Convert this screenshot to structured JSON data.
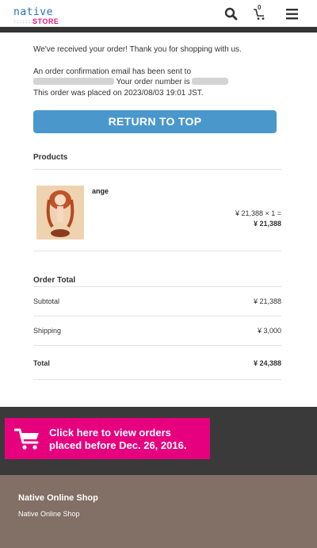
{
  "header": {
    "logo_top": "native",
    "logo_dots": "::::::::",
    "logo_store": "STORE",
    "cart_count": "0",
    "icons": {
      "search": "search-icon",
      "cart": "cart-icon",
      "menu": "hamburger-menu-icon"
    }
  },
  "confirmation": {
    "line1": "We've received your order! Thank you for shopping with us.",
    "line2": "An order confirmation email has been sent to",
    "line3": "Your order number is",
    "line4": "This order was placed on 2023/08/03 19:01 JST."
  },
  "return_button": "RETURN TO TOP",
  "products": {
    "title": "Products",
    "items": [
      {
        "name": "ange",
        "unit_price": "¥ 21,388 × 1 =",
        "total": "¥ 21,388"
      }
    ]
  },
  "order_total": {
    "title": "Order Total",
    "subtotal_label": "Subtotal",
    "subtotal_value": "¥ 21,388",
    "shipping_label": "Shipping",
    "shipping_value": "¥ 3,000",
    "total_label": "Total",
    "total_value": "¥ 24,388"
  },
  "legacy_orders": {
    "line1": "Click here to view orders",
    "line2": "placed before Dec. 26, 2016."
  },
  "footer": {
    "title": "Native Online Shop",
    "subtitle": "Native Online Shop"
  },
  "colors": {
    "accent_blue": "#4a97cc",
    "brand_pink": "#e6007e",
    "footer_brown": "#826f65",
    "dark_band": "#3a3a3a"
  }
}
